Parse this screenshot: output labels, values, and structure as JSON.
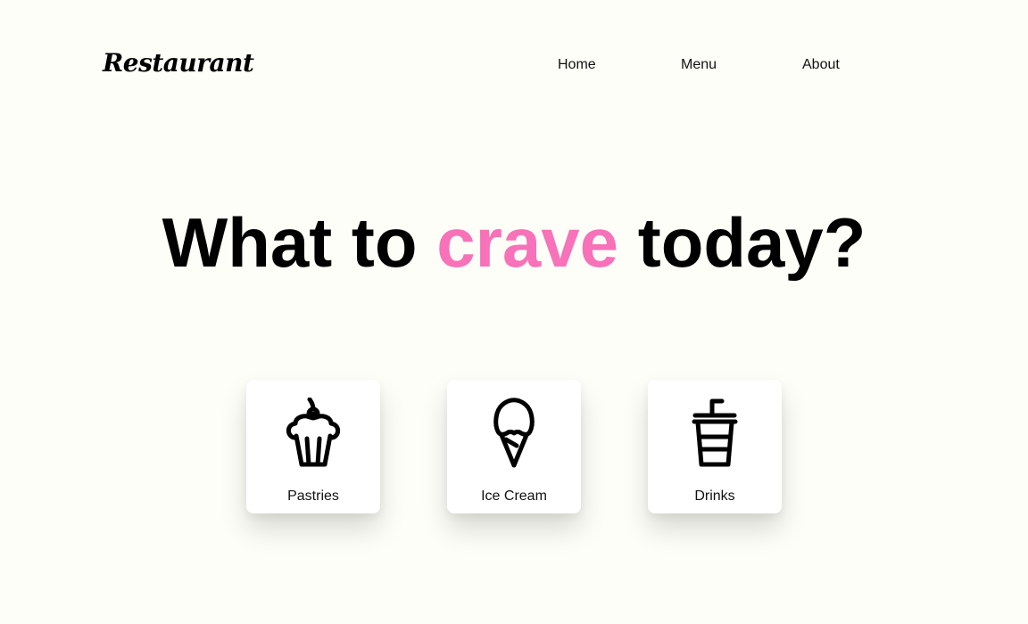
{
  "header": {
    "logo_text": "Restaurant",
    "nav": [
      {
        "label": "Home"
      },
      {
        "label": "Menu"
      },
      {
        "label": "About"
      }
    ]
  },
  "hero": {
    "before": "What to",
    "accent": "crave",
    "after": "today?",
    "accent_color": "#f772b8"
  },
  "categories": [
    {
      "label": "Pastries",
      "icon": "cupcake-icon"
    },
    {
      "label": "Ice Cream",
      "icon": "ice-cream-icon"
    },
    {
      "label": "Drinks",
      "icon": "drink-cup-icon"
    }
  ],
  "colors": {
    "background": "#fefef8",
    "card": "#ffffff",
    "text": "#111111",
    "accent": "#f772b8"
  }
}
